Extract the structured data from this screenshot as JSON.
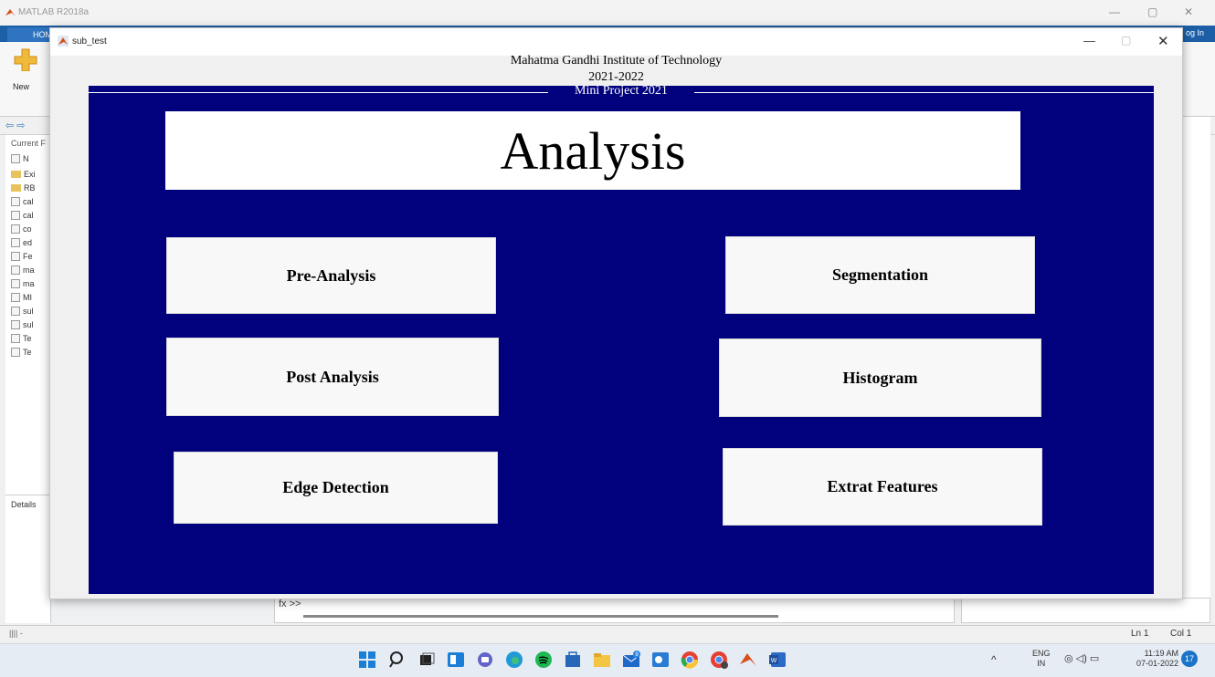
{
  "matlab": {
    "title": "MATLAB R2018a",
    "tab_home": "HOM",
    "login": "og In",
    "new_label": "New",
    "current_folder_label": "Current F",
    "files": [
      "N",
      "Exi",
      "RB",
      "cal",
      "cal",
      "co",
      "ed",
      "Fe",
      "ma",
      "ma",
      "MI",
      "sul",
      "sul",
      "Te",
      "Te"
    ],
    "details_label": "Details",
    "cmd_prompt": "fx >>",
    "status_left": "|||| -",
    "status_ln": "Ln  1",
    "status_col": "Col  1",
    "window_controls": [
      "—",
      "▢",
      "✕"
    ]
  },
  "figure": {
    "window_title": "sub_test",
    "header_line1": "Mahatma Gandhi Institute of Technology",
    "header_line2": "2021-2022",
    "panel_title": "Mini Project 2021",
    "heading": "Analysis",
    "buttons": {
      "pre_analysis": "Pre-Analysis",
      "post_analysis": "Post Analysis",
      "edge_detection": "Edge Detection",
      "segmentation": "Segmentation",
      "histogram": "Histogram",
      "extra_features": "Extrat Features"
    },
    "controls": [
      "—",
      "▢",
      "✕"
    ]
  },
  "taskbar": {
    "apps": [
      "windows-start",
      "search",
      "task-view",
      "widgets",
      "chat",
      "edge",
      "spotify",
      "store",
      "file-explorer",
      "mail",
      "outlook",
      "chrome",
      "chrome-alt",
      "matlab",
      "word"
    ],
    "mail_badge": "9",
    "tray_lang_1": "ENG",
    "tray_lang_2": "IN",
    "clock_time": "11:19 AM",
    "clock_date": "07-01-2022",
    "notification_count": "17",
    "colors": {
      "accent": "#1a73c8",
      "panel_bg": "#01017e"
    }
  }
}
